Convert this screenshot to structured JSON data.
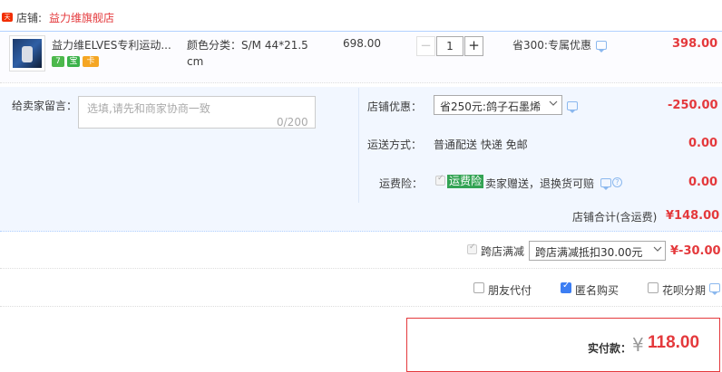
{
  "shop": {
    "badge": "天猫",
    "label": "店铺:",
    "name": "益力维旗舰店"
  },
  "item": {
    "title": "益力维ELVES专利运动...",
    "sku": "颜色分类：S/M 44*21.5 cm",
    "price": "698.00",
    "qty_minus": "−",
    "quantity": "1",
    "qty_plus": "+",
    "promo": "省300:专属优惠",
    "subtotal": "398.00",
    "service_icons": [
      "7",
      "宝",
      "卡"
    ]
  },
  "memo": {
    "label": "给卖家留言：",
    "placeholder": "选填,请先和商家协商一致",
    "counter": "0/200"
  },
  "coupon": {
    "label": "店铺优惠：",
    "selected": "省250元:鸽子石墨烯",
    "amount": "-250.00"
  },
  "shipping": {
    "label": "运送方式：",
    "value": "普通配送 快递 免邮",
    "amount": "0.00"
  },
  "insurance": {
    "label": "运费险：",
    "badge": "运费险",
    "desc": "卖家赠送，退换货可赔",
    "amount": "0.00"
  },
  "shop_total": {
    "label": "店铺合计(含运费)",
    "value": "¥148.00"
  },
  "cross_store": {
    "label": "跨店满减",
    "selected": "跨店满减抵扣30.00元",
    "amount": "¥-30.00"
  },
  "options": [
    {
      "label": "朋友代付",
      "checked": false
    },
    {
      "label": "匿名购买",
      "checked": true
    },
    {
      "label": "花呗分期",
      "checked": false
    }
  ],
  "payment": {
    "label": "实付款：",
    "currency": "¥",
    "amount": "118.00"
  },
  "colors": {
    "accent_red": "#e4393c",
    "blue_bg": "#f2f7ff",
    "insurance_green": "#33a353",
    "checkbox_blue": "#3c7ef3"
  }
}
